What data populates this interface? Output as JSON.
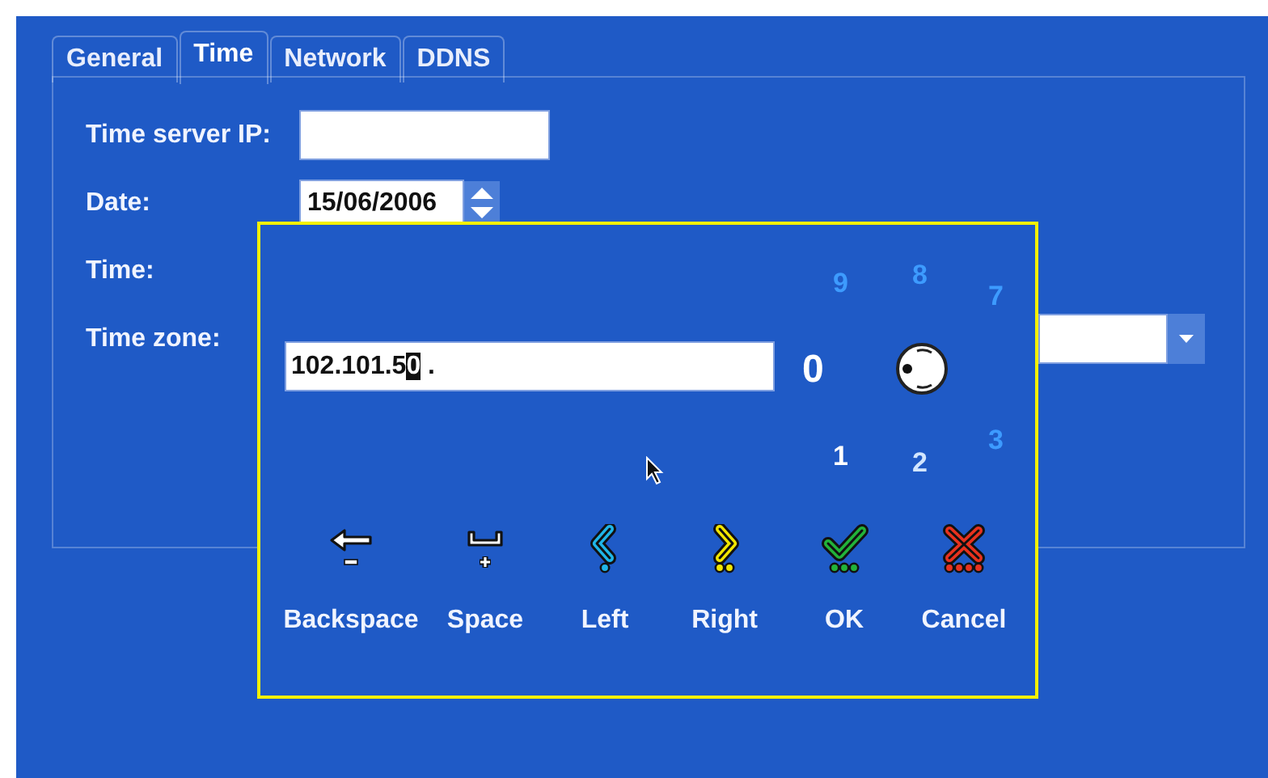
{
  "tabs": [
    {
      "label": "General",
      "selected": false
    },
    {
      "label": "Time",
      "selected": true
    },
    {
      "label": "Network",
      "selected": false
    },
    {
      "label": "DDNS",
      "selected": false
    }
  ],
  "form": {
    "fields": [
      {
        "label": "Time server IP:",
        "kind": "text"
      },
      {
        "label": "Date:",
        "kind": "spinner",
        "value": "15/06/2006"
      },
      {
        "label": "Time:",
        "kind": "hidden"
      },
      {
        "label": "Time zone:",
        "kind": "dropdown"
      }
    ]
  },
  "ip_dialog": {
    "input": {
      "text_before_cursor": "102.101.5",
      "cursor_char": "0",
      "text_after_cursor": " ."
    },
    "dial_digits": [
      {
        "label": "0",
        "color": "#ffffff"
      },
      {
        "label": "1",
        "color": "#ffffff"
      },
      {
        "label": "2",
        "color": "#d2e6ff"
      },
      {
        "label": "3",
        "color": "#3d9bff"
      },
      {
        "label": "7",
        "color": "#3d9bff"
      },
      {
        "label": "8",
        "color": "#3d9bff"
      },
      {
        "label": "9",
        "color": "#3d9bff"
      }
    ],
    "buttons": [
      {
        "label": "Backspace",
        "kind": "backspace"
      },
      {
        "label": "Space",
        "kind": "space"
      },
      {
        "label": "Left",
        "kind": "left"
      },
      {
        "label": "Right",
        "kind": "right"
      },
      {
        "label": "OK",
        "kind": "ok"
      },
      {
        "label": "Cancel",
        "kind": "cancel"
      }
    ]
  }
}
